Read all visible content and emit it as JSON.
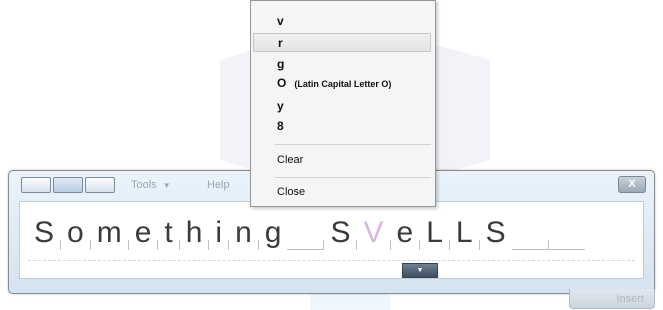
{
  "toolbar": {
    "tools_label": "Tools",
    "help_label": "Help",
    "close_label": "X",
    "insert_label": "Insert"
  },
  "writing": {
    "letters": [
      "S",
      "o",
      "m",
      "e",
      "t",
      "h",
      "i",
      "n",
      "g",
      "S",
      "V",
      "e",
      "L",
      "L",
      "S"
    ],
    "highlighted_index": 10
  },
  "menu": {
    "items": [
      {
        "label": "v",
        "description": ""
      },
      {
        "label": "r",
        "description": ""
      },
      {
        "label": "g",
        "description": ""
      },
      {
        "label": "O",
        "description": "(Latin Capital Letter O)"
      },
      {
        "label": "y",
        "description": ""
      },
      {
        "label": "8",
        "description": ""
      }
    ],
    "clear_label": "Clear",
    "close_label": "Close"
  },
  "colors": {
    "panel_bg": "#dbe7f2",
    "highlight_letter": "#d7b7dc",
    "menu_bg": "#f5f5f5"
  }
}
